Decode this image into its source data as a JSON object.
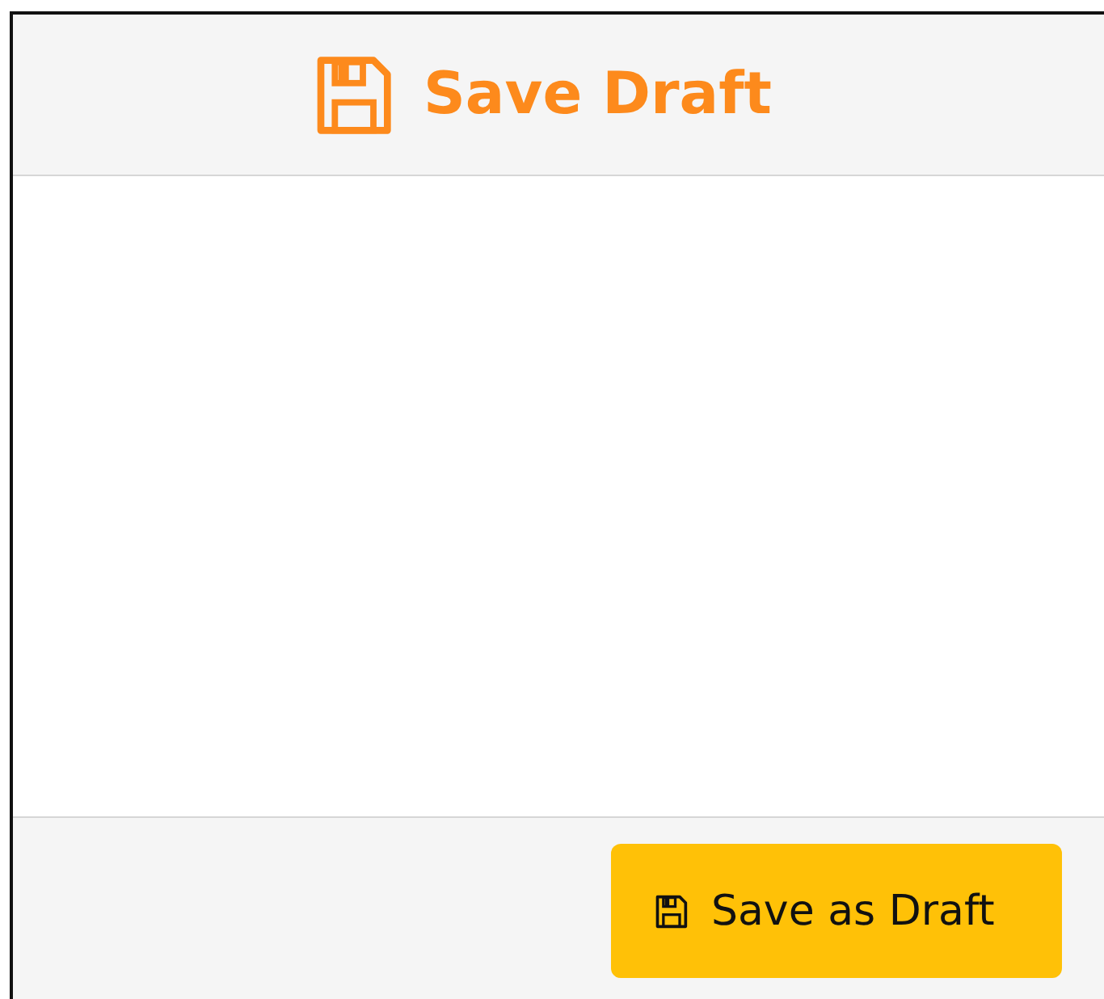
{
  "dialog": {
    "title": "Save Draft"
  },
  "buttons": [
    {
      "label": "Save as Draft",
      "kind": "warning"
    }
  ]
}
